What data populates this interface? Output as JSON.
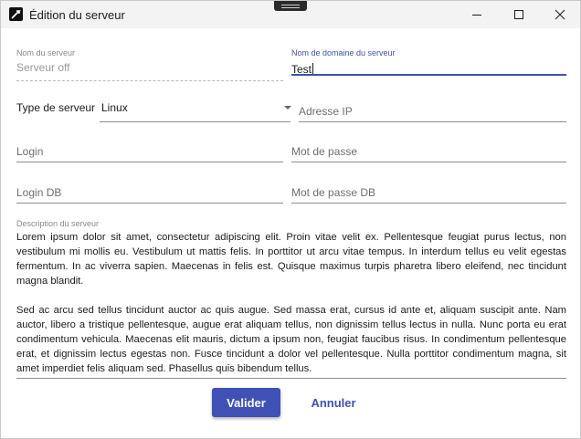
{
  "window": {
    "title": "Édition du serveur",
    "icon": "app-logo-icon"
  },
  "form": {
    "server_name": {
      "label": "Nom du serveur",
      "value": "Serveur off",
      "disabled": true
    },
    "domain_name": {
      "label": "Nom de domaine du serveur",
      "value": "Test",
      "focused": true
    },
    "server_type": {
      "label": "Type de serveur",
      "value": "Linux"
    },
    "ip_address": {
      "placeholder": "Adresse IP"
    },
    "login": {
      "placeholder": "Login"
    },
    "password": {
      "placeholder": "Mot de passe"
    },
    "login_db": {
      "placeholder": "Login DB"
    },
    "password_db": {
      "placeholder": "Mot de passe DB"
    },
    "description": {
      "label": "Description du serveur",
      "paragraph1": "Lorem ipsum dolor sit amet, consectetur adipiscing elit. Proin vitae velit ex. Pellentesque feugiat purus lectus, non vestibulum mi mollis eu. Vestibulum ut mattis felis. In porttitor ut arcu vitae tempus. In interdum tellus eu velit egestas fermentum. In ac viverra sapien. Maecenas in felis est. Quisque maximus turpis pharetra libero eleifend, nec tincidunt magna blandit.",
      "paragraph2": "Sed ac arcu sed tellus tincidunt auctor ac quis augue. Sed massa erat, cursus id ante et, aliquam suscipit ante. Nam auctor, libero a tristique pellentesque, augue erat aliquam tellus, non dignissim tellus lectus in nulla. Nunc porta eu erat condimentum vehicula. Maecenas elit mauris, dictum a ipsum non, feugiat faucibus risus. In condimentum pellentesque erat, et dignissim lectus egestas non. Fusce tincidunt a dolor vel pellentesque. Nulla porttitor condimentum magna, sit amet imperdiet felis aliquam sed. Phasellus quis bibendum tellus."
    }
  },
  "actions": {
    "confirm_label": "Valider",
    "cancel_label": "Annuler"
  },
  "colors": {
    "accent": "#3f51b5",
    "titlebar": "#f3f3f3"
  }
}
